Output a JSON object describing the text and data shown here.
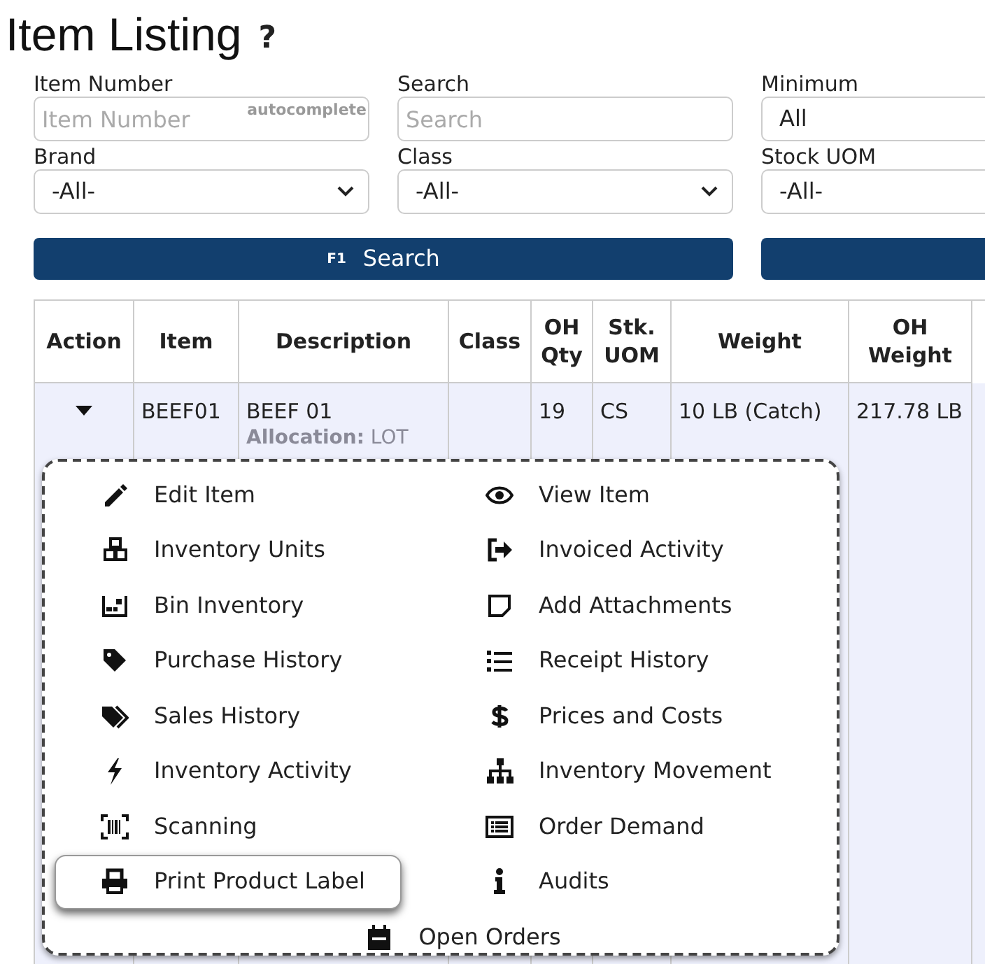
{
  "page": {
    "title": "Item Listing",
    "help": "?"
  },
  "filters": [
    {
      "label": "Item Number",
      "kind": "text",
      "placeholder": "Item Number",
      "hint": "autocomplete"
    },
    {
      "label": "Search",
      "kind": "text",
      "placeholder": "Search"
    },
    {
      "label": "Minimum",
      "kind": "select",
      "value": "All"
    },
    {
      "label": "Brand",
      "kind": "select",
      "value": "-All-"
    },
    {
      "label": "Class",
      "kind": "select",
      "value": "-All-"
    },
    {
      "label": "Stock UOM",
      "kind": "select",
      "value": "-All-"
    }
  ],
  "search_button": {
    "key": "F1",
    "label": "Search"
  },
  "table": {
    "columns": [
      "Action",
      "Item",
      "Description",
      "Class",
      "OH Qty",
      "Stk. UOM",
      "Weight",
      "OH Weight"
    ],
    "rows": [
      {
        "expanded": true,
        "item": "BEEF01",
        "description": "BEEF 01",
        "allocation": "**Allocation:** LOT",
        "class": "",
        "oh_qty": "19",
        "stk_uom": "CS",
        "weight": "10 LB (Catch)",
        "oh_weight": "217.78 LB"
      }
    ]
  },
  "action_menu": {
    "items": [
      {
        "label": "Edit Item",
        "selected": false
      },
      {
        "label": "View Item",
        "selected": false
      },
      {
        "label": "Inventory Units",
        "selected": false
      },
      {
        "label": "Invoiced Activity",
        "selected": false
      },
      {
        "label": "Bin Inventory",
        "selected": false
      },
      {
        "label": "Add Attachments",
        "selected": false
      },
      {
        "label": "Purchase History",
        "selected": false
      },
      {
        "label": "Receipt History",
        "selected": false
      },
      {
        "label": "Sales History",
        "selected": false
      },
      {
        "label": "Prices and Costs",
        "selected": false
      },
      {
        "label": "Inventory Activity",
        "selected": false
      },
      {
        "label": "Inventory Movement",
        "selected": false
      },
      {
        "label": "Scanning",
        "selected": false
      },
      {
        "label": "Order Demand",
        "selected": false
      },
      {
        "label": "Print Product Label",
        "selected": true
      },
      {
        "label": "Audits",
        "selected": false
      },
      {
        "label": "Open Orders",
        "selected": false
      }
    ]
  }
}
